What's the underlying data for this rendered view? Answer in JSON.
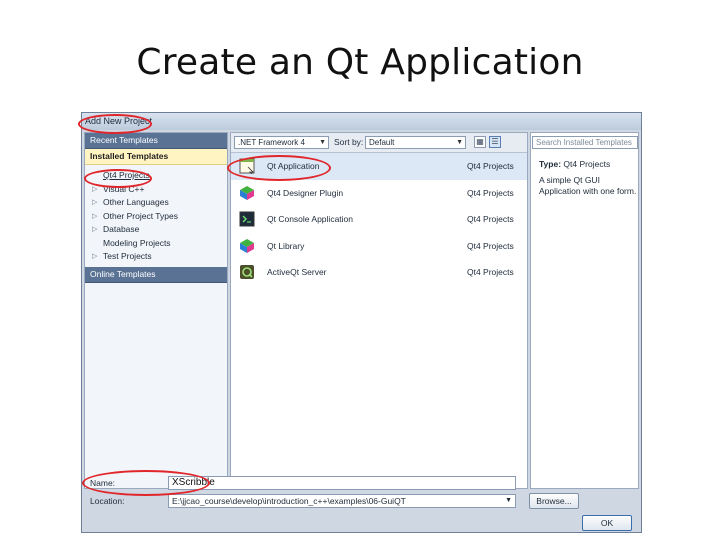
{
  "slide": {
    "title": "Create an Qt Application"
  },
  "dialog": {
    "title": "Add New Project",
    "nav": {
      "recent_templates": "Recent Templates",
      "installed_templates": "Installed Templates",
      "tree": [
        {
          "label": "Qt4 Projects",
          "arrow": "",
          "selected": true
        },
        {
          "label": "Visual C++",
          "arrow": "▷"
        },
        {
          "label": "Other Languages",
          "arrow": "▷"
        },
        {
          "label": "Other Project Types",
          "arrow": "▷"
        },
        {
          "label": "Database",
          "arrow": "▷"
        },
        {
          "label": "Modeling Projects",
          "arrow": ""
        },
        {
          "label": "Test Projects",
          "arrow": "▷"
        }
      ],
      "online_templates": "Online Templates"
    },
    "toolbar": {
      "framework": ".NET Framework 4",
      "sort_label": "Sort by:",
      "sort_value": "Default"
    },
    "templates": [
      {
        "name": "Qt Application",
        "category": "Qt4 Projects",
        "icon": "qt-application-icon",
        "selected": true
      },
      {
        "name": "Qt4 Designer Plugin",
        "category": "Qt4 Projects",
        "icon": "qt-designer-plugin-icon"
      },
      {
        "name": "Qt Console Application",
        "category": "Qt4 Projects",
        "icon": "qt-console-icon"
      },
      {
        "name": "Qt Library",
        "category": "Qt4 Projects",
        "icon": "qt-library-icon"
      },
      {
        "name": "ActiveQt Server",
        "category": "Qt4 Projects",
        "icon": "activeqt-server-icon"
      }
    ],
    "info": {
      "search_placeholder": "Search Installed Templates",
      "type_label": "Type:",
      "type_value": "Qt4 Projects",
      "description": "A simple Qt GUI Application with one form."
    },
    "fields": {
      "name_label": "Name:",
      "name_value": "XScribble",
      "location_label": "Location:",
      "location_value": "E:\\jjcao_course\\develop\\introduction_c++\\examples\\06-GuiQT",
      "browse_label": "Browse...",
      "ok_label": "OK"
    }
  },
  "colors": {
    "highlight": "#e0262b",
    "nav_header": "#5a7395",
    "installed_header": "#fff4c2"
  }
}
